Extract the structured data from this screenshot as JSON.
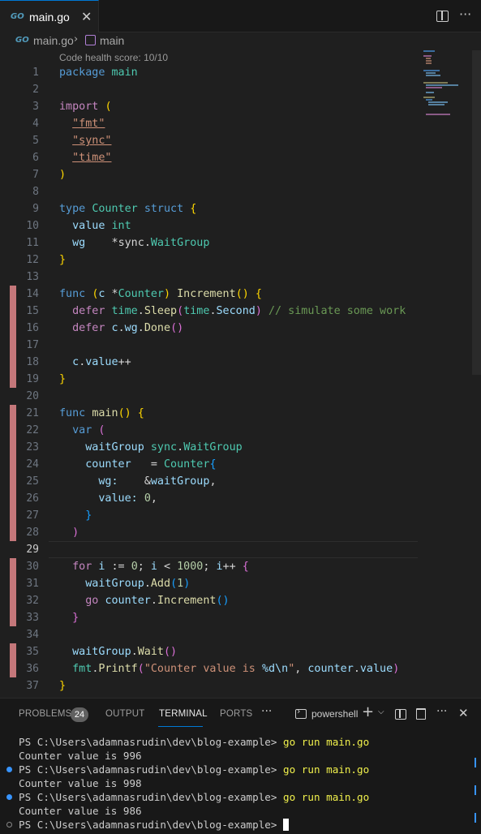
{
  "tab": {
    "icon": "go-file-icon",
    "icon_glyph": "GO",
    "label": "main.go",
    "close": "✕"
  },
  "breadcrumb": {
    "file": "main.go",
    "separator": "›",
    "symbol": "main"
  },
  "editor": {
    "codelens": "Code health score: 10/10",
    "line_numbers": [
      "1",
      "2",
      "3",
      "4",
      "5",
      "6",
      "7",
      "8",
      "9",
      "10",
      "11",
      "12",
      "13",
      "14",
      "15",
      "16",
      "17",
      "18",
      "19",
      "20",
      "21",
      "22",
      "23",
      "24",
      "25",
      "26",
      "27",
      "28",
      "29",
      "30",
      "31",
      "32",
      "33",
      "34",
      "35",
      "36",
      "37"
    ],
    "code": {
      "l1": [
        "package",
        "main"
      ],
      "l3": [
        "import",
        "("
      ],
      "l4": "\"fmt\"",
      "l5": "\"sync\"",
      "l6": "\"time\"",
      "l7": ")",
      "l9": [
        "type",
        "Counter",
        "struct",
        "{"
      ],
      "l10": [
        "value",
        "int"
      ],
      "l11": [
        "wg",
        "*",
        "sync",
        ".",
        "WaitGroup"
      ],
      "l12": "}",
      "l14": [
        "func",
        "(",
        "c",
        "*",
        "Counter",
        ")",
        "Increment",
        "()",
        "{"
      ],
      "l15": [
        "defer",
        "time",
        ".",
        "Sleep",
        "(",
        "time",
        ".",
        "Second",
        ")",
        "// simulate some work"
      ],
      "l16": [
        "defer",
        "c",
        ".",
        "wg",
        ".",
        "Done",
        "()"
      ],
      "l18": [
        "c",
        ".",
        "value",
        "++"
      ],
      "l19": "}",
      "l21": [
        "func",
        "main",
        "()",
        "{"
      ],
      "l22": [
        "var",
        "("
      ],
      "l23": [
        "waitGroup",
        "sync",
        ".",
        "WaitGroup"
      ],
      "l24": [
        "counter",
        "=",
        "Counter",
        "{"
      ],
      "l25": [
        "wg:",
        "&",
        "waitGroup",
        ","
      ],
      "l26": [
        "value:",
        "0",
        ","
      ],
      "l27": "}",
      "l28": ")",
      "l30": [
        "for",
        "i",
        ":=",
        "0",
        ";",
        "i",
        "<",
        "1000",
        ";",
        "i",
        "++",
        "{"
      ],
      "l31": [
        "waitGroup",
        ".",
        "Add",
        "(",
        "1",
        ")"
      ],
      "l32": [
        "go",
        "counter",
        ".",
        "Increment",
        "()"
      ],
      "l33": "}",
      "l35": [
        "waitGroup",
        ".",
        "Wait",
        "()"
      ],
      "l36": [
        "fmt",
        ".",
        "Printf",
        "(",
        "\"Counter value is ",
        "%d\\n",
        "\"",
        ",",
        "counter",
        ".",
        "value",
        ")"
      ],
      "l37": "}"
    }
  },
  "panel": {
    "tabs": [
      "PROBLEMS",
      "OUTPUT",
      "TERMINAL",
      "PORTS"
    ],
    "active_tab": "TERMINAL",
    "problems_count": "24",
    "more": "···",
    "terminal_name": "powershell",
    "close": "✕"
  },
  "terminal": [
    {
      "prompt": "PS C:\\Users\\adamnasrudin\\dev\\blog-example> ",
      "command": "go run main.go",
      "marker": "none"
    },
    {
      "output": "Counter value is 996"
    },
    {
      "prompt": "PS C:\\Users\\adamnasrudin\\dev\\blog-example> ",
      "command": "go run main.go",
      "marker": "blue"
    },
    {
      "output": "Counter value is 998"
    },
    {
      "prompt": "PS C:\\Users\\adamnasrudin\\dev\\blog-example> ",
      "command": "go run main.go",
      "marker": "blue"
    },
    {
      "output": "Counter value is 986"
    },
    {
      "prompt": "PS C:\\Users\\adamnasrudin\\dev\\blog-example> ",
      "command": "",
      "marker": "empty"
    }
  ],
  "colors": {
    "accent": "#0078d4",
    "gutter_modified": "#c4777a",
    "badge": "#616161"
  }
}
